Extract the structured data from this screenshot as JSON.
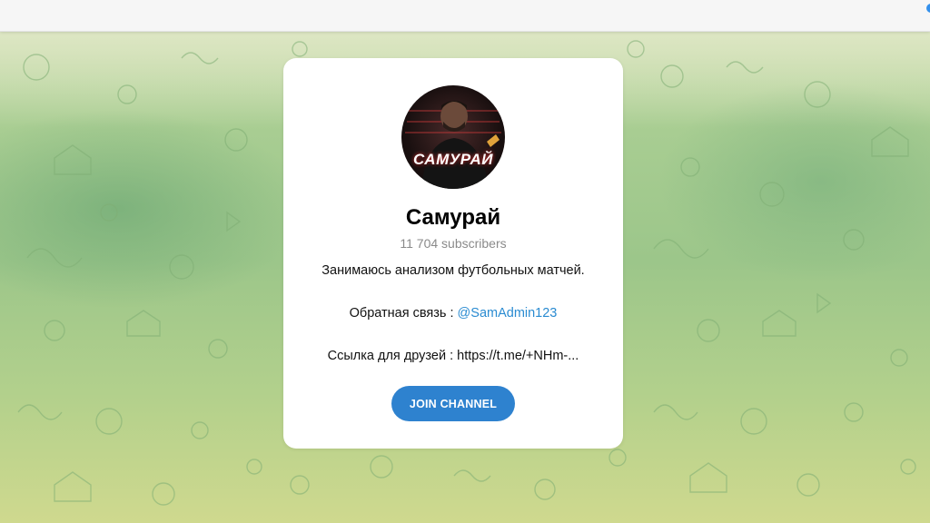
{
  "channel": {
    "avatar_text": "САМУРАЙ",
    "title": "Самурай",
    "subscribers": "11 704 subscribers",
    "description_line1": "Занимаюсь анализом футбольных матчей.",
    "feedback_prefix": "Обратная связь : ",
    "feedback_link": "@SamAdmin123",
    "friends_line": "Ссылка для друзей : https://t.me/+NHm-..."
  },
  "actions": {
    "join_label": "JOIN CHANNEL"
  },
  "colors": {
    "accent": "#2e82cf",
    "link": "#2a8bd1",
    "background": "#a8cd92"
  }
}
